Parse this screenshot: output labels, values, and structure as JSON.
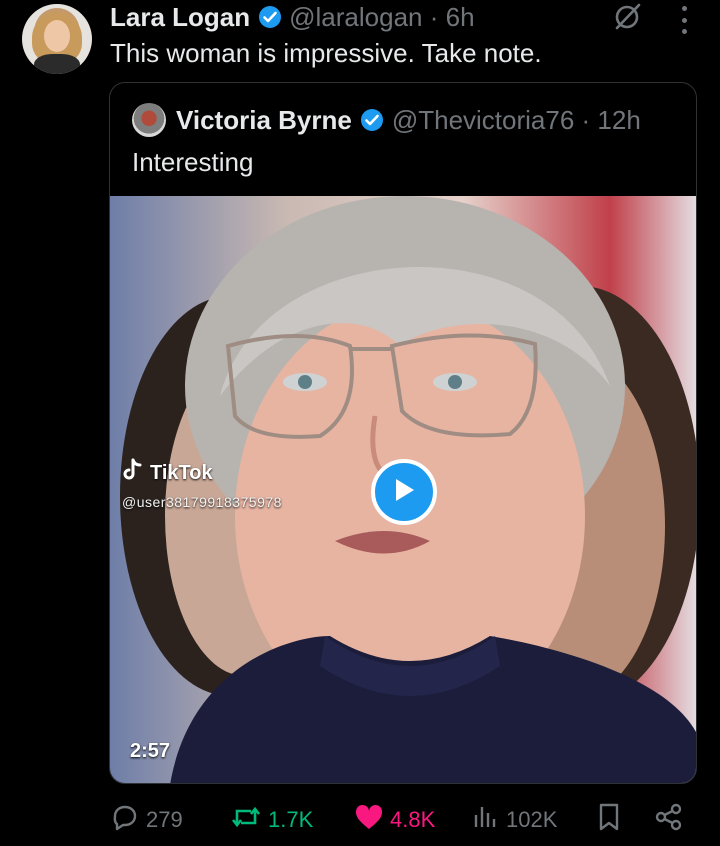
{
  "tweet": {
    "author_name": "Lara Logan",
    "author_handle_time": "@laralogan · 6h",
    "text": "This woman is impressive. Take note."
  },
  "quoted": {
    "author_name": "Victoria Byrne",
    "author_handle_time": "@Thevictoria76 · 12h",
    "text": "Interesting",
    "media": {
      "watermark_label": "TikTok",
      "watermark_user": "@user38179918375978",
      "duration": "2:57"
    }
  },
  "actions": {
    "replies": "279",
    "reposts": "1.7K",
    "likes": "4.8K",
    "views": "102K"
  },
  "colors": {
    "verified": "#1d9bf0",
    "repost_active": "#00ba7c",
    "like_active": "#f91880",
    "muted": "#71767b"
  },
  "icons": [
    "verified-badge-icon",
    "grok-icon",
    "more-icon",
    "play-icon",
    "tiktok-icon",
    "reply-icon",
    "repost-icon",
    "like-icon",
    "views-icon",
    "bookmark-icon",
    "share-icon"
  ]
}
